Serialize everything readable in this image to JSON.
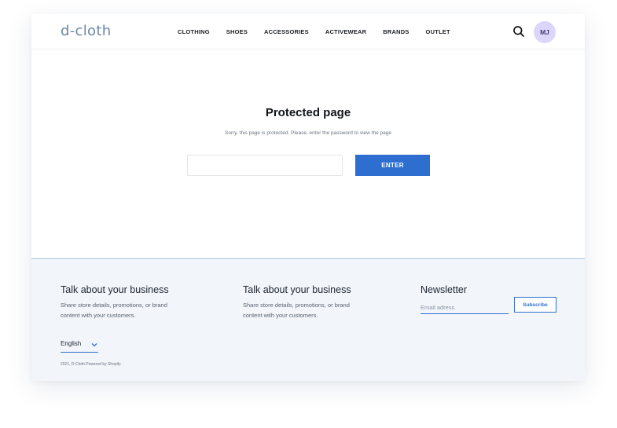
{
  "header": {
    "logo": "d-cloth",
    "nav": [
      "CLOTHING",
      "SHOES",
      "ACCESSORIES",
      "ACTIVEWEAR",
      "BRANDS",
      "OUTLET"
    ],
    "avatar_initials": "MJ",
    "search_icon": "search-icon"
  },
  "main": {
    "title": "Protected page",
    "subtitle": "Sorry, this page is protected. Please, enter the password to view the page",
    "password_value": "",
    "enter_label": "ENTER"
  },
  "footer": {
    "col1": {
      "title": "Talk about your business",
      "text": "Share store details, promotions, or brand content with your customers."
    },
    "col2": {
      "title": "Talk about your business",
      "text": "Share store details, promotions, or brand content with your customers."
    },
    "newsletter": {
      "title": "Newsletter",
      "email_placeholder": "Email adress",
      "subscribe_label": "Subscribe"
    },
    "language": "English",
    "copyright": "2021, D-Cloth Powered by Shopify"
  },
  "colors": {
    "accent": "#2d6ecf",
    "logo": "#6d88a6",
    "avatar_bg": "#dcd6fb",
    "footer_bg": "#f2f5fa"
  }
}
